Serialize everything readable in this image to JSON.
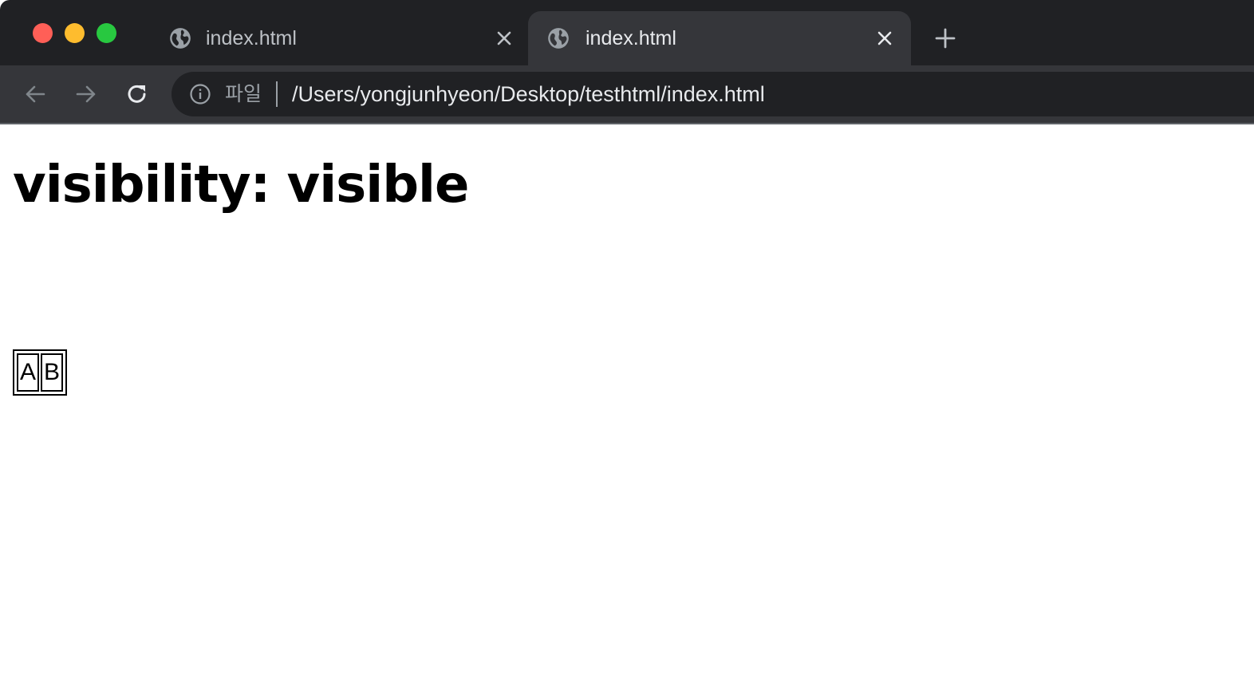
{
  "window": {
    "traffic_lights": {
      "close": "#ff5f57",
      "minimize": "#febc2e",
      "zoom": "#28c840"
    }
  },
  "tabs": [
    {
      "title": "index.html",
      "icon": "globe-icon",
      "active": false
    },
    {
      "title": "index.html",
      "icon": "globe-icon",
      "active": true
    }
  ],
  "toolbar": {
    "back_icon": "arrow-left-icon",
    "forward_icon": "arrow-right-icon",
    "reload_icon": "reload-icon",
    "new_tab_icon": "plus-icon"
  },
  "address_bar": {
    "scheme_label": "파일",
    "url": "/Users/yongjunhyeon/Desktop/testhtml/index.html",
    "info_icon": "info-icon"
  },
  "page": {
    "heading": "visibility: visible",
    "table": {
      "cells": [
        "A",
        "B"
      ]
    }
  },
  "colors": {
    "tabstrip": "#202124",
    "active_tab": "#35363a",
    "omnibox": "#202124",
    "text_light": "#e8eaed",
    "text_dim": "#9aa0a6"
  }
}
